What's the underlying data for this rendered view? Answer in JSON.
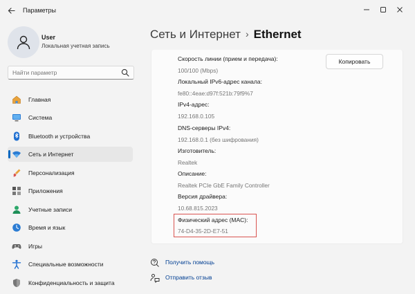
{
  "window": {
    "title": "Параметры"
  },
  "profile": {
    "name": "User",
    "account_type": "Локальная учетная запись"
  },
  "search": {
    "placeholder": "Найти параметр"
  },
  "nav": {
    "items": [
      {
        "label": "Главная"
      },
      {
        "label": "Система"
      },
      {
        "label": "Bluetooth и устройства"
      },
      {
        "label": "Сеть и Интернет"
      },
      {
        "label": "Персонализация"
      },
      {
        "label": "Приложения"
      },
      {
        "label": "Учетные записи"
      },
      {
        "label": "Время и язык"
      },
      {
        "label": "Игры"
      },
      {
        "label": "Специальные возможности"
      },
      {
        "label": "Конфиденциальность и защита"
      }
    ],
    "active": "Сеть и Интернет"
  },
  "breadcrumb": {
    "parent": "Сеть и Интернет",
    "separator": "›",
    "current": "Ethernet"
  },
  "properties": {
    "copy_label": "Копировать",
    "rows": [
      {
        "label": "Скорость линии (прием и передача):",
        "value": "100/100 (Mbps)"
      },
      {
        "label": "Локальный IPv6-адрес канала:",
        "value": "fe80::4eae:d97f:521b:79f9%7"
      },
      {
        "label": "IPv4-адрес:",
        "value": "192.168.0.105"
      },
      {
        "label": "DNS-серверы IPv4:",
        "value": "192.168.0.1 (без шифрования)"
      },
      {
        "label": "Изготовитель:",
        "value": "Realtek"
      },
      {
        "label": "Описание:",
        "value": "Realtek PCIe GbE Family Controller"
      },
      {
        "label": "Версия драйвера:",
        "value": "10.68.815.2023"
      },
      {
        "label": "Физический адрес (MAC):",
        "value": "74-D4-35-2D-E7-51"
      }
    ]
  },
  "links": {
    "help": "Получить помощь",
    "feedback": "Отправить отзыв"
  },
  "colors": {
    "accent": "#0067c0",
    "highlight": "#d9534f",
    "link": "#003e92"
  }
}
